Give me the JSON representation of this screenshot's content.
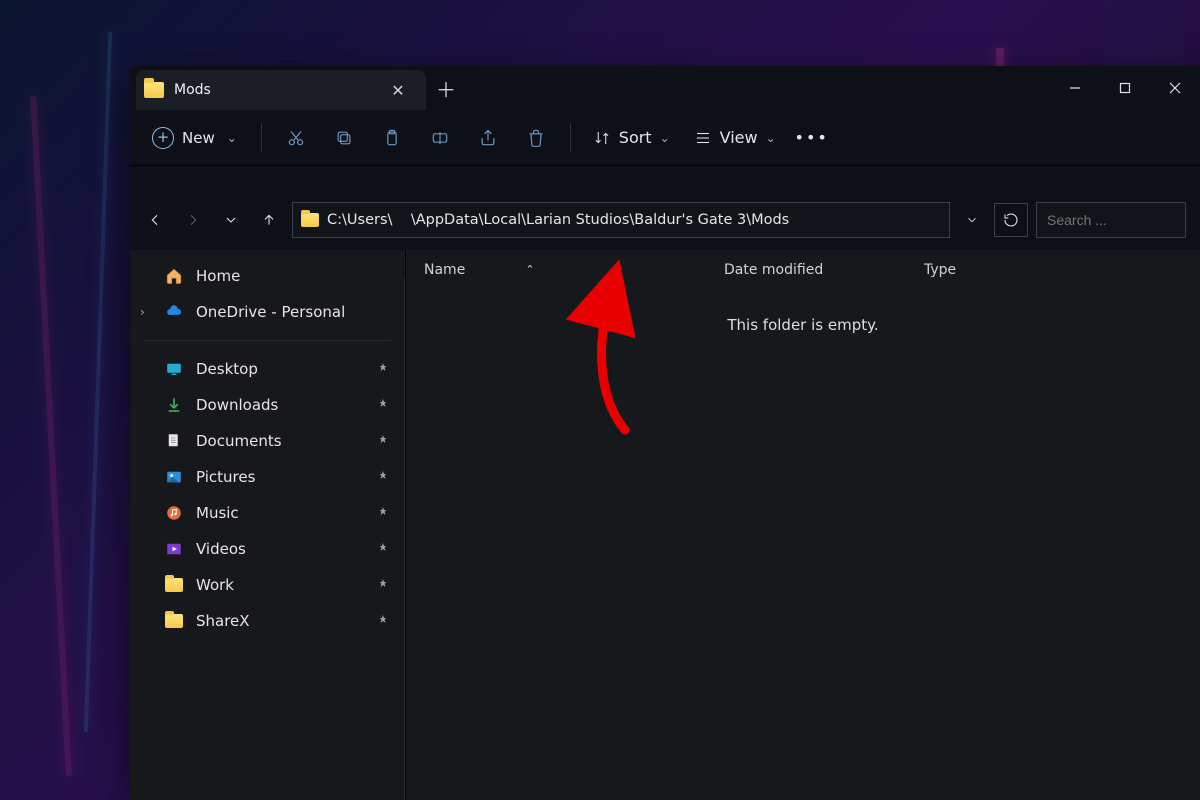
{
  "tab": {
    "title": "Mods"
  },
  "toolbar": {
    "new_label": "New",
    "sort_label": "Sort",
    "view_label": "View"
  },
  "address": {
    "path": "C:\\Users\\    \\AppData\\Local\\Larian Studios\\Baldur's Gate 3\\Mods"
  },
  "search": {
    "placeholder": "Search ..."
  },
  "sidebar": {
    "home": "Home",
    "onedrive": "OneDrive - Personal",
    "items": [
      {
        "label": "Desktop"
      },
      {
        "label": "Downloads"
      },
      {
        "label": "Documents"
      },
      {
        "label": "Pictures"
      },
      {
        "label": "Music"
      },
      {
        "label": "Videos"
      },
      {
        "label": "Work"
      },
      {
        "label": "ShareX"
      }
    ]
  },
  "columns": {
    "name": "Name",
    "date": "Date modified",
    "type": "Type"
  },
  "empty_message": "This folder is empty."
}
